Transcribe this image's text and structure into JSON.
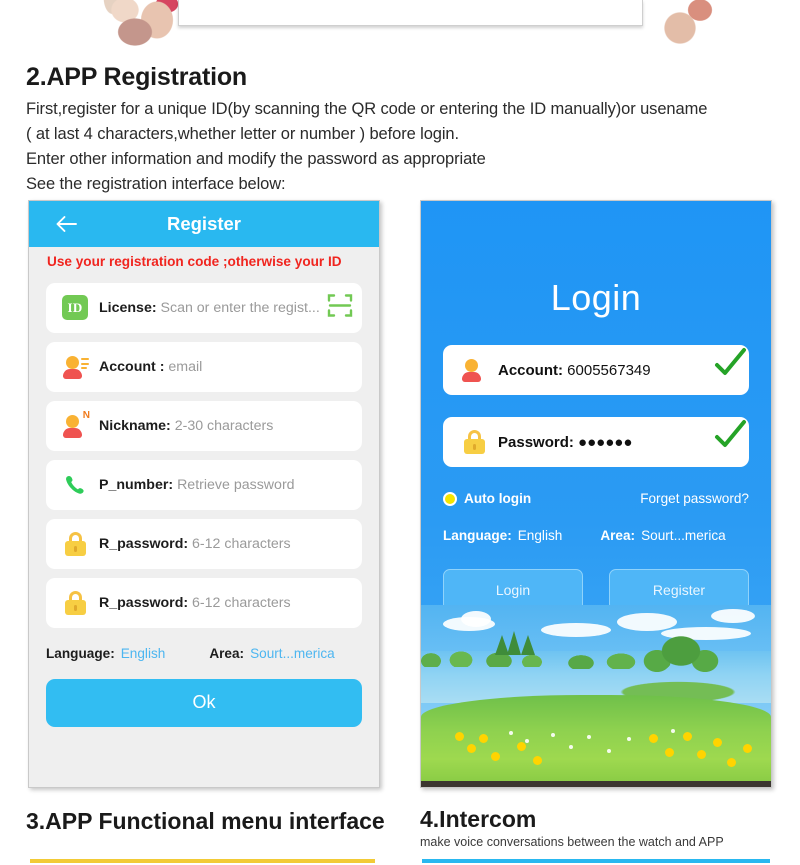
{
  "section2": {
    "heading": "2.APP Registration",
    "paragraph_lines": [
      "First,register for a unique ID(by scanning the QR code or entering the ID manually)or usename",
      "( at last 4 characters,whether letter or number ) before login.",
      "Enter other information and modify the password as appropriate",
      "See the registration interface below:"
    ]
  },
  "register_screen": {
    "back_icon": "back-arrow-icon",
    "title": "Register",
    "warning": "Use your registration code ;otherwise your ID",
    "fields": [
      {
        "icon": "id-badge-icon",
        "icon_text": "ID",
        "label": "License:",
        "placeholder": "Scan or enter the regist...",
        "trailing_icon": "qr-scan-icon"
      },
      {
        "icon": "account-person-icon",
        "label": "Account :",
        "placeholder": "email"
      },
      {
        "icon": "nickname-person-icon",
        "icon_text": "N",
        "label": "Nickname:",
        "placeholder": "2-30 characters"
      },
      {
        "icon": "phone-icon",
        "label": "P_number:",
        "placeholder": "Retrieve password"
      },
      {
        "icon": "lock-icon",
        "label": "R_password:",
        "placeholder": "6-12 characters"
      },
      {
        "icon": "lock-icon",
        "label": "R_password:",
        "placeholder": "6-12 characters"
      }
    ],
    "language_label": "Language:",
    "language_value": "English",
    "area_label": "Area:",
    "area_value": "Sourt...merica",
    "ok_button": "Ok",
    "colors": {
      "header": "#29b8f0",
      "warning_text": "#f0251f",
      "link": "#4db6f0",
      "ok_button": "#32bdf2"
    }
  },
  "login_screen": {
    "title": "Login",
    "account_label": "Account:",
    "account_value": "6005567349",
    "account_icon": "account-person-icon",
    "account_check": "green-check-icon",
    "password_label": "Password:",
    "password_value": "●●●●●●",
    "password_icon": "lock-icon",
    "password_check": "green-check-icon",
    "auto_login_label": "Auto login",
    "auto_login_selected": true,
    "forget_password_label": "Forget password?",
    "language_label": "Language:",
    "language_value": "English",
    "area_label": "Area:",
    "area_value": "Sourt...merica",
    "login_button": "Login",
    "register_button": "Register",
    "colors": {
      "background": "#2196f3",
      "radio": "#f5e500",
      "check": "#25a327",
      "button": "#4fb6f7"
    }
  },
  "section3": {
    "heading": "3.APP Functional menu interface",
    "rule_color": "#f2cb36"
  },
  "section4": {
    "heading": "4.Intercom",
    "subtitle": "make voice conversations between the watch and APP",
    "rule_color": "#29b8f0"
  }
}
